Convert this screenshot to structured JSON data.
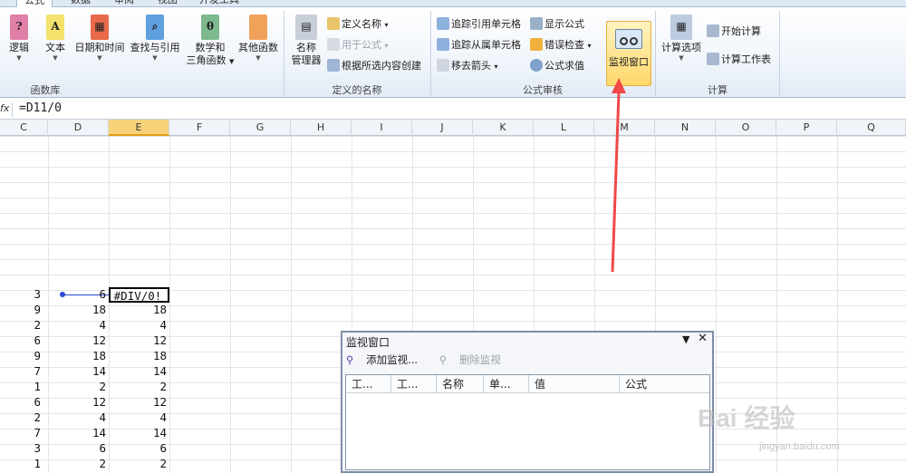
{
  "tabs": [
    {
      "label": "公式",
      "active": true
    },
    {
      "label": "数据",
      "active": false
    },
    {
      "label": "审阅",
      "active": false
    },
    {
      "label": "视图",
      "active": false
    },
    {
      "label": "开发工具",
      "active": false
    }
  ],
  "ribbon": {
    "func_library": {
      "group_label": "函数库",
      "buttons": [
        "逻辑",
        "文本",
        "日期和时间",
        "查找与引用",
        "数学和",
        "三角函数",
        "其他函数"
      ]
    },
    "defined_names": {
      "group_label": "定义的名称",
      "name_manager": "名称",
      "name_manager_2": "管理器",
      "define_name": "定义名称",
      "use_in_formula": "用于公式",
      "create_from_selection": "根据所选内容创建"
    },
    "auditing": {
      "group_label": "公式审核",
      "trace_precedents": "追踪引用单元格",
      "trace_dependents": "追踪从属单元格",
      "remove_arrows": "移去箭头",
      "show_formulas": "显示公式",
      "error_checking": "错误检查",
      "evaluate_formula": "公式求值",
      "watch_window": "监视窗口"
    },
    "calculation": {
      "group_label": "计算",
      "calc_options": "计算选项",
      "calc_now": "开始计算",
      "calc_sheet": "计算工作表"
    }
  },
  "formula_bar": {
    "fx": "fx",
    "formula": "=D11/0"
  },
  "columns": [
    "C",
    "D",
    "E",
    "F",
    "G",
    "H",
    "I",
    "J",
    "K",
    "L",
    "M",
    "N",
    "O",
    "P",
    "Q"
  ],
  "selected_column": "E",
  "rows": [
    {
      "c": "3",
      "d": "6",
      "e": "#DIV/0!"
    },
    {
      "c": "9",
      "d": "18",
      "e": "18"
    },
    {
      "c": "2",
      "d": "4",
      "e": "4"
    },
    {
      "c": "6",
      "d": "12",
      "e": "12"
    },
    {
      "c": "9",
      "d": "18",
      "e": "18"
    },
    {
      "c": "7",
      "d": "14",
      "e": "14"
    },
    {
      "c": "1",
      "d": "2",
      "e": "2"
    },
    {
      "c": "6",
      "d": "12",
      "e": "12"
    },
    {
      "c": "2",
      "d": "4",
      "e": "4"
    },
    {
      "c": "7",
      "d": "14",
      "e": "14"
    },
    {
      "c": "3",
      "d": "6",
      "e": "6"
    },
    {
      "c": "1",
      "d": "2",
      "e": "2"
    }
  ],
  "watch_window": {
    "title": "监视窗口",
    "add_watch": "添加监视...",
    "delete_watch": "删除监视",
    "headers": [
      "工...",
      "工...",
      "名称",
      "单...",
      "值",
      "公式"
    ]
  },
  "watermark": {
    "brand": "Bai 经验",
    "url": "jingyan.baidu.com"
  },
  "colors": {
    "accent": "#ffd86b",
    "arrow": "#f04848",
    "trace": "#2a47d6"
  }
}
